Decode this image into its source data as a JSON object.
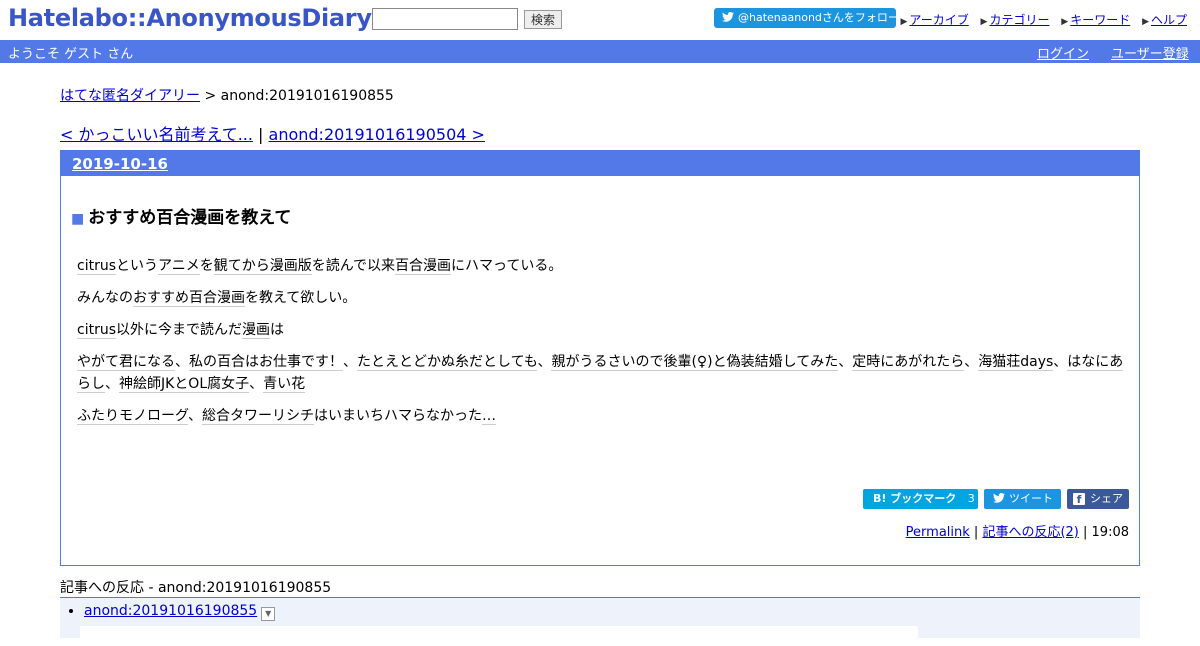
{
  "header": {
    "logo": "Hatelabo::AnonymousDiary",
    "search_placeholder": "",
    "search_button": "検索",
    "follow_button": "@hatenaanondさんをフォロー",
    "links": [
      "アーカイブ",
      "カテゴリー",
      "キーワード",
      "ヘルプ"
    ]
  },
  "bar": {
    "welcome": "ようこそ ゲスト さん",
    "login": "ログイン",
    "register": "ユーザー登録"
  },
  "breadcrumb": {
    "home": "はてな匿名ダイアリー",
    "separator": " > ",
    "current": "anond:20191016190855"
  },
  "nav": {
    "prev": "< かっこいい名前考えて...",
    "separator": " | ",
    "next": "anond:20191016190504 >"
  },
  "entry": {
    "date": "2019-10-16",
    "title_marker": "■",
    "title": "おすすめ百合漫画を教えて",
    "p1": {
      "k1": "citrus",
      "t1": "という",
      "k2": "アニメ",
      "t2": "を",
      "k3": "観てから",
      "k4": "漫画版",
      "t3": "を読んで以来",
      "k5": "百合漫画",
      "t4": "にハマっている。"
    },
    "p2": {
      "t1": "みんなの",
      "k1": "おすすめ",
      "k2": "百合漫画",
      "t2": "を教えて欲しい。"
    },
    "p3": {
      "k1": "citrus",
      "t1": "以外に今まで読んだ",
      "k2": "漫画",
      "t2": "は"
    },
    "p4": {
      "k1": "やがて君になる",
      "t1": "、",
      "k2": "私の百合はお仕事です！",
      "t2": "、",
      "k3": "たとえとどかぬ糸だとしても",
      "t3": "、",
      "k4": "親がうるさいので後輩(♀)と偽装結婚してみた",
      "t4": "、",
      "k5": "定時にあがれたら",
      "t5": "、",
      "k6": "海猫荘days",
      "t6": "、",
      "k7": "はなにあらし",
      "t7": "、",
      "k8": "神絵師JKとOL腐女子",
      "t8": "、",
      "k9": "青い花"
    },
    "p5": {
      "k1": "ふたりモノローグ",
      "t1": "、",
      "k2": "総合タワーリシチ",
      "t2": "はいまいちハマらなかった",
      "k3": "…"
    },
    "share": {
      "hatena": "B! ブックマーク",
      "hatena_count": "3",
      "tweet": "ツイート",
      "facebook": "シェア"
    },
    "meta": {
      "permalink": "Permalink",
      "sep": " | ",
      "reactions": "記事への反応(2)",
      "time": "19:08"
    }
  },
  "reactions": {
    "header": "記事への反応 - anond:20191016190855",
    "items": [
      "anond:20191016190855"
    ]
  },
  "colors": {
    "accent": "#5279e7",
    "link": "#0000cc",
    "hatena": "#00a4de",
    "twitter": "#1b95e0",
    "facebook": "#3b5998"
  }
}
